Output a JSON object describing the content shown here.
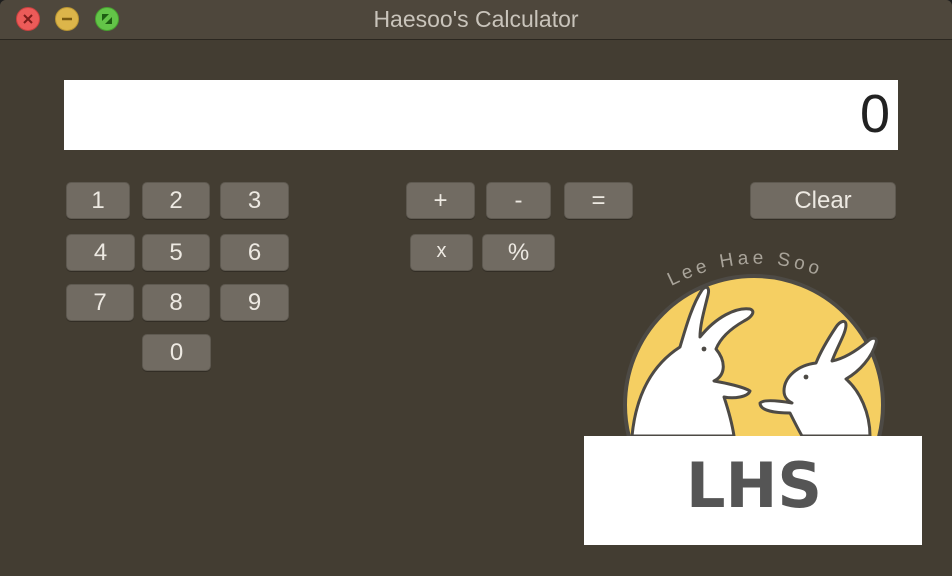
{
  "window": {
    "title": "Haesoo's Calculator",
    "controls": {
      "close": "close-icon",
      "minimize": "minimize-icon",
      "zoom": "zoom-icon"
    }
  },
  "display": {
    "value": "0"
  },
  "keypad": {
    "digits": [
      "1",
      "2",
      "3",
      "4",
      "5",
      "6",
      "7",
      "8",
      "9",
      "0"
    ]
  },
  "operators": {
    "plus": "+",
    "minus": "-",
    "equals": "=",
    "multiply": "x",
    "percent": "%"
  },
  "clear_label": "Clear",
  "logo": {
    "arc_text": "Lee Hae Soo",
    "initials": "LHS"
  },
  "colors": {
    "window_bg": "#433d32",
    "button_bg": "#716b62",
    "logo_sun": "#f5cf62",
    "logo_text": "#555555"
  }
}
